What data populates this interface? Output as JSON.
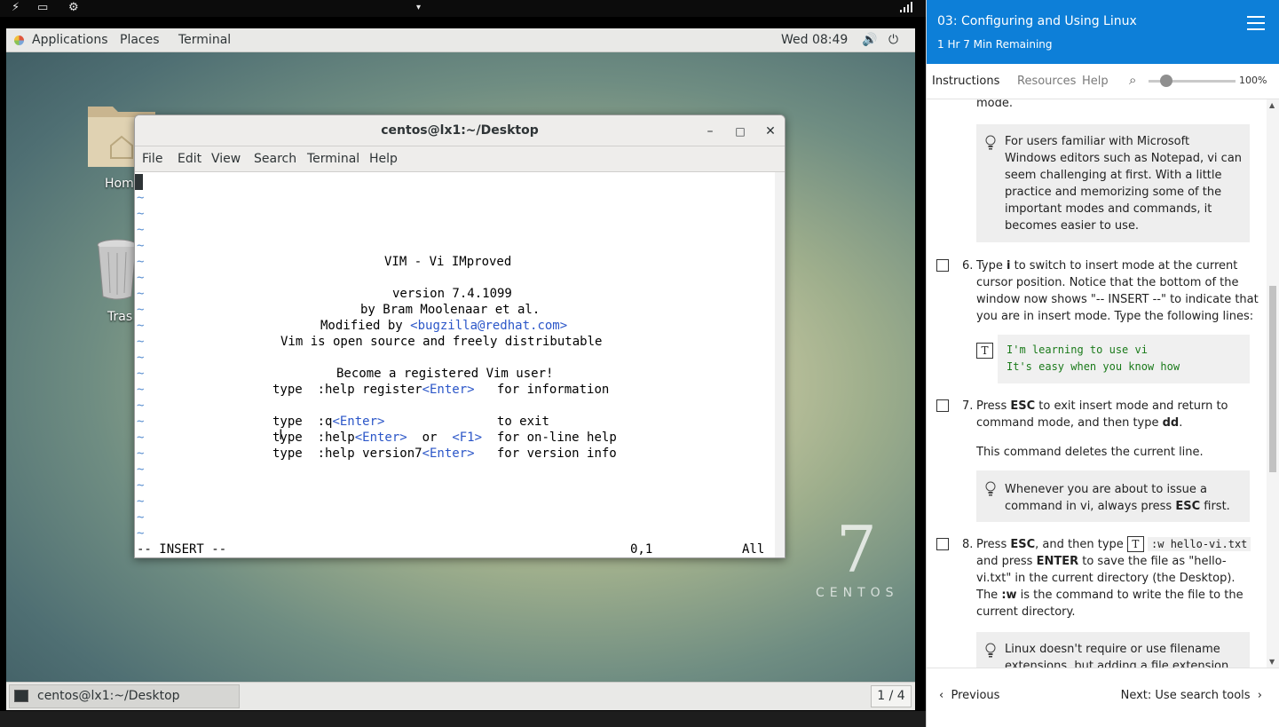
{
  "host": {
    "left_icons": [
      "bolt-icon",
      "monitor-icon",
      "settings-gear-icon"
    ],
    "center_icon": "pin-icon",
    "right_icon": "signal-bars-icon"
  },
  "gnome": {
    "menus": [
      "Applications",
      "Places",
      "Terminal"
    ],
    "clock": "Wed 08:49",
    "tray_icons": [
      "volume-icon",
      "power-icon"
    ]
  },
  "desktop": {
    "icons": [
      {
        "label": "Hom",
        "icon": "home-folder-icon"
      },
      {
        "label": "Tras",
        "icon": "trash-icon"
      }
    ],
    "brand_number": "7",
    "brand_word": "CENTOS"
  },
  "terminal": {
    "title": "centos@lx1:~/Desktop",
    "menu": [
      "File",
      "Edit",
      "View",
      "Search",
      "Terminal",
      "Help"
    ],
    "vim_lines": [
      {
        "row": 5,
        "indent": 31,
        "parts": [
          {
            "t": "VIM - Vi IMproved"
          }
        ]
      },
      {
        "row": 7,
        "indent": 32,
        "parts": [
          {
            "t": "version 7.4.1099"
          }
        ]
      },
      {
        "row": 8,
        "indent": 28,
        "parts": [
          {
            "t": "by Bram Moolenaar et al."
          }
        ]
      },
      {
        "row": 9,
        "indent": 23,
        "parts": [
          {
            "t": "Modified by "
          },
          {
            "t": "<bugzilla@redhat.com>",
            "c": "blue"
          }
        ]
      },
      {
        "row": 10,
        "indent": 18,
        "parts": [
          {
            "t": "Vim is open source and freely distributable"
          }
        ]
      },
      {
        "row": 12,
        "indent": 25,
        "parts": [
          {
            "t": "Become a registered Vim user!"
          }
        ]
      },
      {
        "row": 13,
        "indent": 17,
        "parts": [
          {
            "t": "type  :help register"
          },
          {
            "t": "<Enter>",
            "c": "blue"
          },
          {
            "t": "   for information"
          }
        ]
      },
      {
        "row": 15,
        "indent": 17,
        "parts": [
          {
            "t": "type  :q"
          },
          {
            "t": "<Enter>",
            "c": "blue"
          },
          {
            "t": "               to exit"
          }
        ]
      },
      {
        "row": 16,
        "indent": 17,
        "parts": [
          {
            "t": "type  :help"
          },
          {
            "t": "<Enter>",
            "c": "blue"
          },
          {
            "t": "  or  "
          },
          {
            "t": "<F1>",
            "c": "blue"
          },
          {
            "t": "  for on-line help"
          }
        ]
      },
      {
        "row": 17,
        "indent": 17,
        "parts": [
          {
            "t": "type  :help version7"
          },
          {
            "t": "<Enter>",
            "c": "blue"
          },
          {
            "t": "   for version info"
          }
        ]
      }
    ],
    "tilde_rows": 22,
    "mode": "-- INSERT --",
    "position": "0,1",
    "scroll": "All"
  },
  "taskbar": {
    "item": "centos@lx1:~/Desktop",
    "workspace": "1 / 4"
  },
  "panel": {
    "title": "03: Configuring and Using Linux",
    "remaining": "1 Hr 7 Min Remaining",
    "tabs": [
      "Instructions",
      "Resources",
      "Help"
    ],
    "zoom": "100%",
    "zoom_fraction": 0.2,
    "frag_top": "mode.",
    "note1": "For users familiar with Microsoft Windows editors such as Notepad, vi can seem challenging at first. With a little practice and memorizing some of the important modes and commands, it becomes easier to use.",
    "step6": {
      "num": "6.",
      "pre": "Type ",
      "key": "i",
      "post": " to switch to insert mode at the current cursor position. Notice that the bottom of the window now shows \"-- INSERT --\" to indicate that you are in insert mode. Type the following lines:"
    },
    "code6": [
      "I'm learning to use vi",
      "It's easy when you know how"
    ],
    "step7": {
      "num": "7.",
      "pre": "Press ",
      "key": "ESC",
      "mid": " to exit insert mode and return to command mode, and then type ",
      "key2": "dd",
      "post": "."
    },
    "step7_extra": "This command deletes the current line.",
    "note2": {
      "pre": "Whenever you are about to issue a command in vi, always press ",
      "key": "ESC",
      "post": " first."
    },
    "step8": {
      "num": "8.",
      "pre": "Press ",
      "key": "ESC",
      "mid": ", and then type ",
      "code": ":w hello-vi.txt",
      "mid2": " and press ",
      "key2": "ENTER",
      "mid3": " to save the file as \"hello-vi.txt\" in the current directory (the Desktop). The ",
      "key3": ":w",
      "post": " is the command to write the file to the current directory."
    },
    "note3": "Linux doesn't require or use filename extensions, but adding a file extension",
    "prev": "Previous",
    "next": "Next: Use search tools"
  }
}
